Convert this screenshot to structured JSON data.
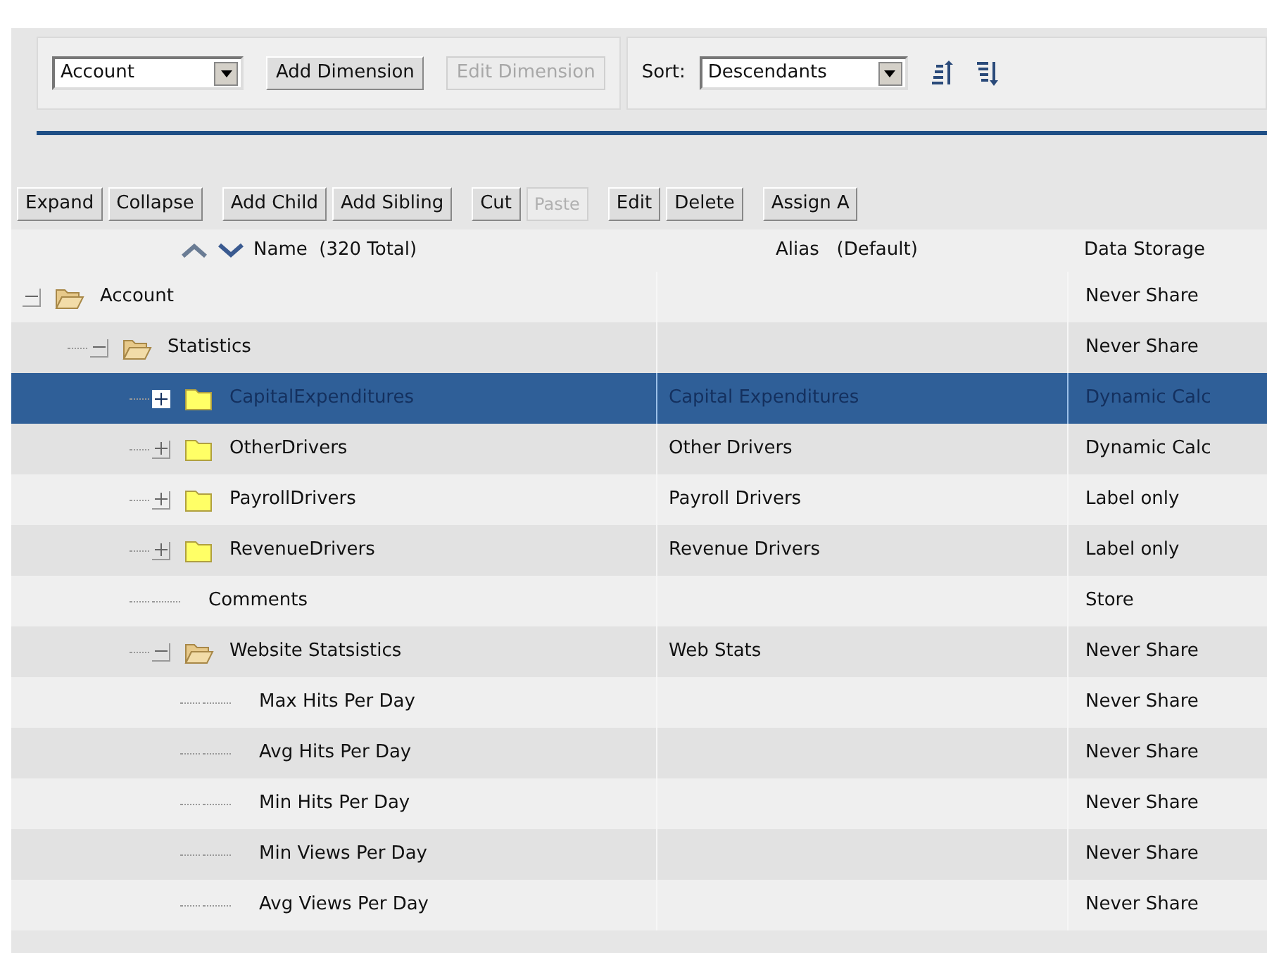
{
  "toolbar": {
    "dimension_select": "Account",
    "buttons": [
      {
        "label": "Add Dimension",
        "disabled": false
      },
      {
        "label": "Edit Dimension",
        "disabled": true
      }
    ],
    "sort_label": "Sort:",
    "sort_select": "Descendants"
  },
  "action_groups": [
    [
      {
        "label": "Expand",
        "disabled": false
      },
      {
        "label": "Collapse",
        "disabled": false
      }
    ],
    [
      {
        "label": "Add Child",
        "disabled": false
      },
      {
        "label": "Add Sibling",
        "disabled": false
      }
    ],
    [
      {
        "label": "Cut",
        "disabled": false
      },
      {
        "label": "Paste",
        "disabled": true
      }
    ],
    [
      {
        "label": "Edit",
        "disabled": false
      },
      {
        "label": "Delete",
        "disabled": false
      }
    ],
    [
      {
        "label": "Assign A",
        "disabled": false
      }
    ]
  ],
  "columns": {
    "name": "Name",
    "name_total": "(320 Total)",
    "alias": "Alias",
    "alias_table": "(Default)",
    "storage": "Data Storage"
  },
  "tree": [
    {
      "name": "Account",
      "storage": "Never Share",
      "kind": "folder",
      "expanded": true,
      "selected": false,
      "children": [
        {
          "name": "Statistics",
          "storage": "Never Share",
          "kind": "folder",
          "expanded": true,
          "selected": false,
          "children": [
            {
              "name": "CapitalExpenditures",
              "alias": "Capital Expenditures",
              "storage": "Dynamic Calc",
              "kind": "folder",
              "expanded": false,
              "selected": true
            },
            {
              "name": "OtherDrivers",
              "alias": "Other Drivers",
              "storage": "Dynamic Calc",
              "kind": "folder",
              "expanded": false,
              "selected": false
            },
            {
              "name": "PayrollDrivers",
              "alias": "Payroll Drivers",
              "storage": "Label only",
              "kind": "folder",
              "expanded": false,
              "selected": false
            },
            {
              "name": "RevenueDrivers",
              "alias": "Revenue Drivers",
              "storage": "Label only",
              "kind": "folder",
              "expanded": false,
              "selected": false
            },
            {
              "name": "Comments",
              "storage": "Store",
              "kind": "leaf",
              "selected": false
            },
            {
              "name": "Website Statsistics",
              "alias": "Web Stats",
              "storage": "Never Share",
              "kind": "folder",
              "expanded": true,
              "selected": false,
              "children": [
                {
                  "name": "Max Hits Per Day",
                  "storage": "Never Share",
                  "kind": "leaf",
                  "selected": false
                },
                {
                  "name": "Avg Hits Per Day",
                  "storage": "Never Share",
                  "kind": "leaf",
                  "selected": false
                },
                {
                  "name": "Min Hits Per Day",
                  "storage": "Never Share",
                  "kind": "leaf",
                  "selected": false
                },
                {
                  "name": "Min Views Per Day",
                  "storage": "Never Share",
                  "kind": "leaf",
                  "selected": false
                },
                {
                  "name": "Avg Views Per Day",
                  "storage": "Never Share",
                  "kind": "leaf",
                  "selected": false
                }
              ]
            }
          ]
        }
      ]
    }
  ]
}
